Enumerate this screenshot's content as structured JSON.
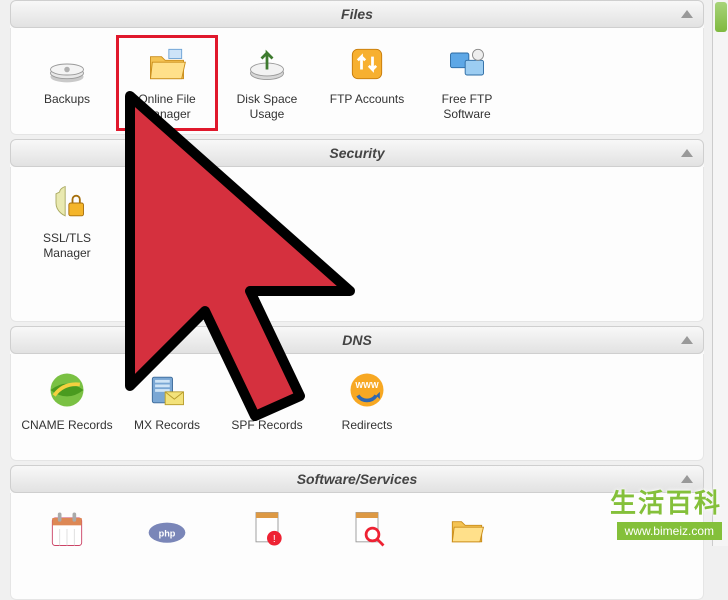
{
  "sections": {
    "files": {
      "title": "Files",
      "items": [
        {
          "label": "Backups"
        },
        {
          "label": "Online File Manager"
        },
        {
          "label": "Disk Space Usage"
        },
        {
          "label": "FTP Accounts"
        },
        {
          "label": "Free FTP Software"
        }
      ]
    },
    "security": {
      "title": "Security",
      "items": [
        {
          "label": "SSL/TLS Manager"
        }
      ]
    },
    "dns": {
      "title": "DNS",
      "items": [
        {
          "label": "CNAME Records"
        },
        {
          "label": "MX Records"
        },
        {
          "label": "SPF Records"
        },
        {
          "label": "Redirects"
        }
      ]
    },
    "software": {
      "title": "Software/Services",
      "items": [
        {
          "label": ""
        },
        {
          "label": ""
        },
        {
          "label": ""
        },
        {
          "label": ""
        },
        {
          "label": ""
        }
      ]
    }
  },
  "watermark": {
    "line1": "生活百科",
    "line2": "www.bimeiz.com"
  }
}
